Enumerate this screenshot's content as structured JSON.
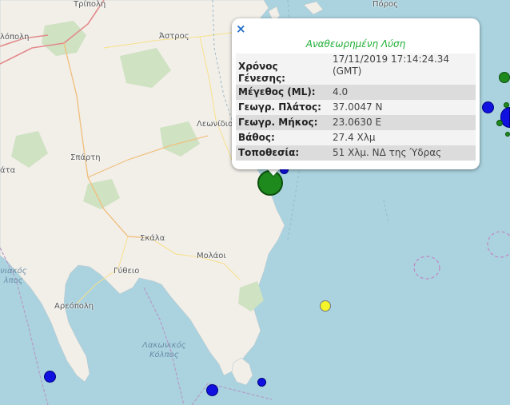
{
  "map": {
    "places": [
      {
        "id": "tripoli",
        "label": "Τρίπολη"
      },
      {
        "id": "poros",
        "label": "Πόρος"
      },
      {
        "id": "megalopoli",
        "label": "λόπολη"
      },
      {
        "id": "astros",
        "label": "Άστρος"
      },
      {
        "id": "leonidio",
        "label": "Λεωνίδιο"
      },
      {
        "id": "sparti",
        "label": "Σπάρτη"
      },
      {
        "id": "kalamata",
        "label": "άτα"
      },
      {
        "id": "skala",
        "label": "Σκάλα"
      },
      {
        "id": "molaoi",
        "label": "Μολάοι"
      },
      {
        "id": "gytheio",
        "label": "Γύθειο"
      },
      {
        "id": "areopoli",
        "label": "Αρεόπολη"
      }
    ],
    "water_labels": [
      {
        "id": "messiniakos",
        "line1": "νιακός",
        "line2": "λπος"
      },
      {
        "id": "lakonikos",
        "line1": "Λακωνικός",
        "line2": "Κόλπος"
      }
    ],
    "colors": {
      "sea": "#aad3df",
      "land": "#f2efe9",
      "green_quake": "#1e8a1e",
      "blue_quake": "#1010e0",
      "yellow_quake": "#f4f42a"
    }
  },
  "popup": {
    "close_icon": "×",
    "title": "Αναθεωρημένη Λύση",
    "rows": [
      {
        "key": "Χρόνος Γένεσης:",
        "value": "17/11/2019 17:14:24.34 (GMT)"
      },
      {
        "key": "Μέγεθος (ML):",
        "value": "4.0"
      },
      {
        "key": "Γεωγρ. Πλάτος:",
        "value": "37.0047 N"
      },
      {
        "key": "Γεωγρ. Μήκος:",
        "value": "23.0630 E"
      },
      {
        "key": "Βάθος:",
        "value": "27.4 Χλμ"
      },
      {
        "key": "Τοποθεσία:",
        "value": "51 Χλμ. ΝΔ της Ύδρας"
      }
    ]
  }
}
